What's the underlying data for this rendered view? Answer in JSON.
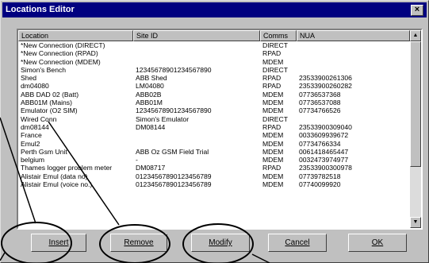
{
  "window": {
    "title": "Locations Editor",
    "close_glyph": "×"
  },
  "columns": [
    "Location",
    "Site ID",
    "Comms",
    "NUA"
  ],
  "rows": [
    [
      "*New Connection (DIRECT)",
      "",
      "DIRECT",
      ""
    ],
    [
      "*New Connection (RPAD)",
      "",
      "RPAD",
      ""
    ],
    [
      "*New Connection (MDEM)",
      "",
      "MDEM",
      ""
    ],
    [
      "Simon's Bench",
      "12345678901234567890",
      "DIRECT",
      ""
    ],
    [
      "Shed",
      "ABB Shed",
      "RPAD",
      "23533900261306"
    ],
    [
      "dm04080",
      "LM04080",
      "RPAD",
      "23533900260282"
    ],
    [
      "ABB DAD 02 (Batt)",
      "ABB02B",
      "MDEM",
      "07736537368"
    ],
    [
      "ABB01M (Mains)",
      "ABB01M",
      "MDEM",
      "07736537088"
    ],
    [
      "Emulator (O2 SIM)",
      "12345678901234567890",
      "MDEM",
      "07734766526"
    ],
    [
      "Wired Conn",
      "Simon's Emulator",
      "DIRECT",
      ""
    ],
    [
      "dm08144",
      "DM08144",
      "RPAD",
      "23533900309040"
    ],
    [
      "France",
      "",
      "MDEM",
      "0033609939672"
    ],
    [
      "Emul2",
      "",
      "MDEM",
      "07734766334"
    ],
    [
      "Perth Gsm Unit",
      "ABB Oz GSM Field Trial",
      "MDEM",
      "0061418465447"
    ],
    [
      "belgium",
      "-",
      "MDEM",
      "0032473974977"
    ],
    [
      "Thames logger problem meter",
      "DM08717",
      "RPAD",
      "23533900300978"
    ],
    [
      "Alistair Emul (data no)",
      "01234567890123456789",
      "MDEM",
      "07739782518"
    ],
    [
      "Alistair Emul (voice no.)",
      "01234567890123456789",
      "MDEM",
      "07740099920"
    ]
  ],
  "buttons": {
    "insert": "Insert",
    "remove": "Remove",
    "modify": "Modify",
    "cancel": "Cancel",
    "ok": "OK"
  },
  "scroll_up_glyph": "▲",
  "scroll_down_glyph": "▼"
}
